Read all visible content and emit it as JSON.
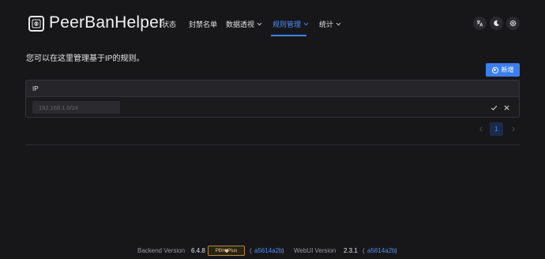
{
  "header": {
    "brand": "PeerBanHelper",
    "nav": [
      {
        "label": "状态",
        "dropdown": false,
        "active": false
      },
      {
        "label": "封禁名单",
        "dropdown": false,
        "active": false
      },
      {
        "label": "数据透视",
        "dropdown": true,
        "active": false
      },
      {
        "label": "规则管理",
        "dropdown": true,
        "active": true
      },
      {
        "label": "统计",
        "dropdown": true,
        "active": false
      }
    ],
    "icons": [
      "translate-icon",
      "moon-icon",
      "settings-gear-icon"
    ]
  },
  "main": {
    "intro": "您可以在这里管理基于IP的规则。",
    "add_button_label": "新增",
    "table": {
      "column_header": "IP",
      "input_placeholder": "192.168.1.0/24"
    },
    "pagination": {
      "current_page": "1"
    }
  },
  "footer": {
    "backend_label": "Backend Version",
    "backend_version": "6.4.8",
    "plus_badge": "PBH Plus",
    "backend_commit": "a5614a2b",
    "webui_label": "WebUI Version",
    "webui_version": "2.3.1",
    "webui_commit": "a5614a2b"
  },
  "colors": {
    "background": "#17171a",
    "accent": "#3b82f6",
    "plus_gold": "#e8c77a"
  }
}
